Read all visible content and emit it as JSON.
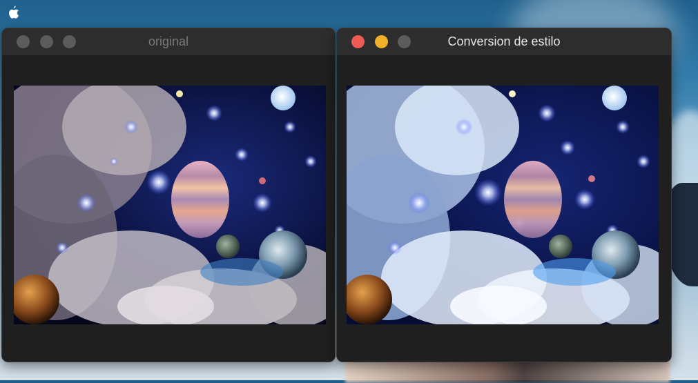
{
  "desktop": {
    "menubar_icon": "apple-icon"
  },
  "windows": [
    {
      "title": "original",
      "active": false,
      "traffic_lights": [
        "close-icon",
        "minimize-icon",
        "zoom-icon"
      ],
      "image_label": "space-scene-image"
    },
    {
      "title": "Conversion de estilo",
      "active": true,
      "traffic_lights": [
        "close-icon",
        "minimize-icon",
        "zoom-icon"
      ],
      "colors": {
        "close": "#ee5b52",
        "minimize": "#f0b027",
        "zoom": "#5c5c5c"
      },
      "image_label": "styled-space-scene-image"
    }
  ]
}
